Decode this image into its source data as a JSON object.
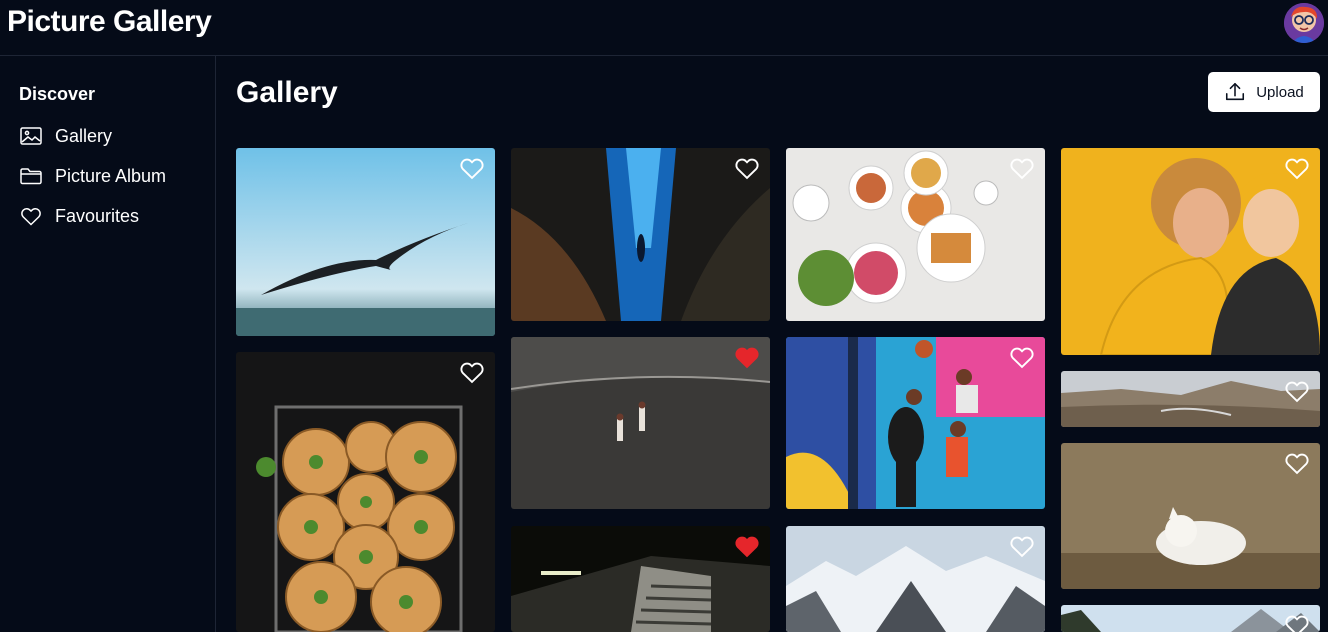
{
  "app": {
    "title": "Picture Gallery"
  },
  "sidebar": {
    "heading": "Discover",
    "items": [
      {
        "label": "Gallery",
        "icon": "image-icon"
      },
      {
        "label": "Picture Album",
        "icon": "folder-icon"
      },
      {
        "label": "Favourites",
        "icon": "heart-icon"
      }
    ]
  },
  "main": {
    "title": "Gallery",
    "upload_label": "Upload"
  },
  "photos": [
    {
      "subject": "seagull",
      "favourite": false
    },
    {
      "subject": "underwater-diver",
      "favourite": false
    },
    {
      "subject": "breakfast-table",
      "favourite": false
    },
    {
      "subject": "laughing-women",
      "favourite": false
    },
    {
      "subject": "bread-rolls",
      "favourite": false
    },
    {
      "subject": "beach-runners",
      "favourite": true
    },
    {
      "subject": "basketball-players",
      "favourite": false
    },
    {
      "subject": "volcanic-landscape",
      "favourite": false
    },
    {
      "subject": "white-kitten",
      "favourite": false
    },
    {
      "subject": "stairway",
      "favourite": true
    },
    {
      "subject": "snowy-mountains",
      "favourite": false
    },
    {
      "subject": "mountain-forest",
      "favourite": false
    }
  ],
  "colors": {
    "background": "#050b18",
    "favourite": "#e5262b"
  }
}
